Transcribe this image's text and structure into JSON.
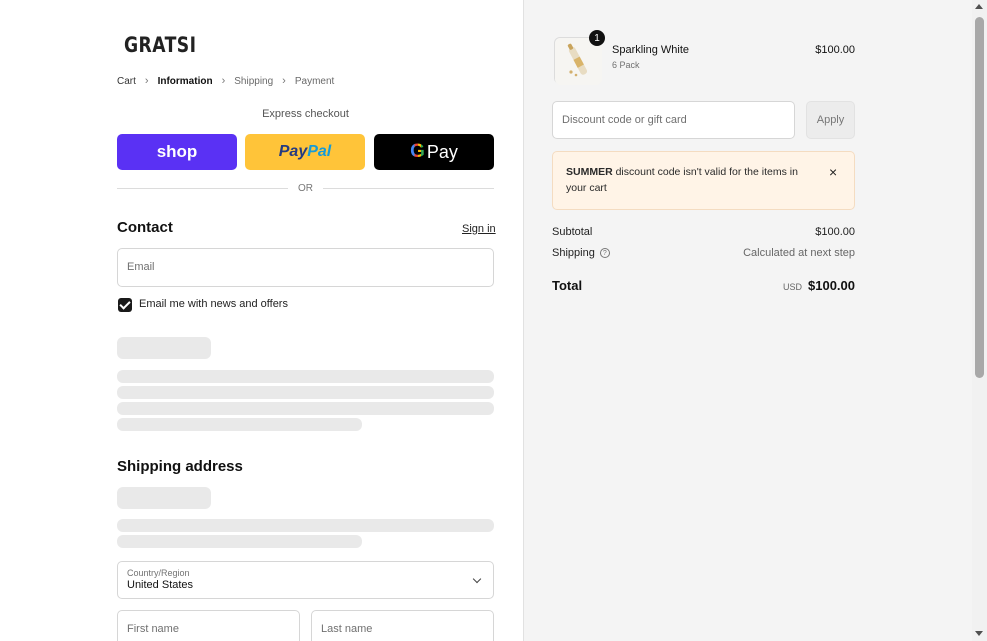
{
  "brand": {
    "logo_text": "GRATSI"
  },
  "breadcrumb": {
    "items": [
      {
        "label": "Cart"
      },
      {
        "label": "Information"
      },
      {
        "label": "Shipping"
      },
      {
        "label": "Payment"
      }
    ],
    "separator": "›"
  },
  "express": {
    "label": "Express checkout",
    "shop_label": "shop",
    "paypal_part1": "Pay",
    "paypal_part2": "Pal",
    "gpay_g": "G",
    "gpay_label": "Pay",
    "or_label": "OR"
  },
  "contact": {
    "title": "Contact",
    "signin_label": "Sign in",
    "email_placeholder": "Email",
    "newsletter_label": "Email me with news and offers",
    "newsletter_checked": true
  },
  "shipping": {
    "title": "Shipping address",
    "country_label": "Country/Region",
    "country_value": "United States",
    "first_name_placeholder": "First name",
    "last_name_placeholder": "Last name"
  },
  "order": {
    "product": {
      "name": "Sparkling White",
      "variant": "6 Pack",
      "price": "$100.00",
      "quantity": "1"
    },
    "discount_placeholder": "Discount code or gift card",
    "apply_label": "Apply",
    "alert": {
      "code": "SUMMER",
      "message": " discount code isn't valid for the items in your cart",
      "close_icon": "×"
    },
    "subtotal_label": "Subtotal",
    "subtotal_value": "$100.00",
    "shipping_label": "Shipping",
    "shipping_help_icon": "?",
    "shipping_value": "Calculated at next step",
    "total_label": "Total",
    "currency": "USD",
    "total_value": "$100.00"
  },
  "colors": {
    "shop_pay": "#5a31f4",
    "paypal": "#ffc439",
    "gpay": "#000000",
    "alert_bg": "#fff4e7"
  }
}
